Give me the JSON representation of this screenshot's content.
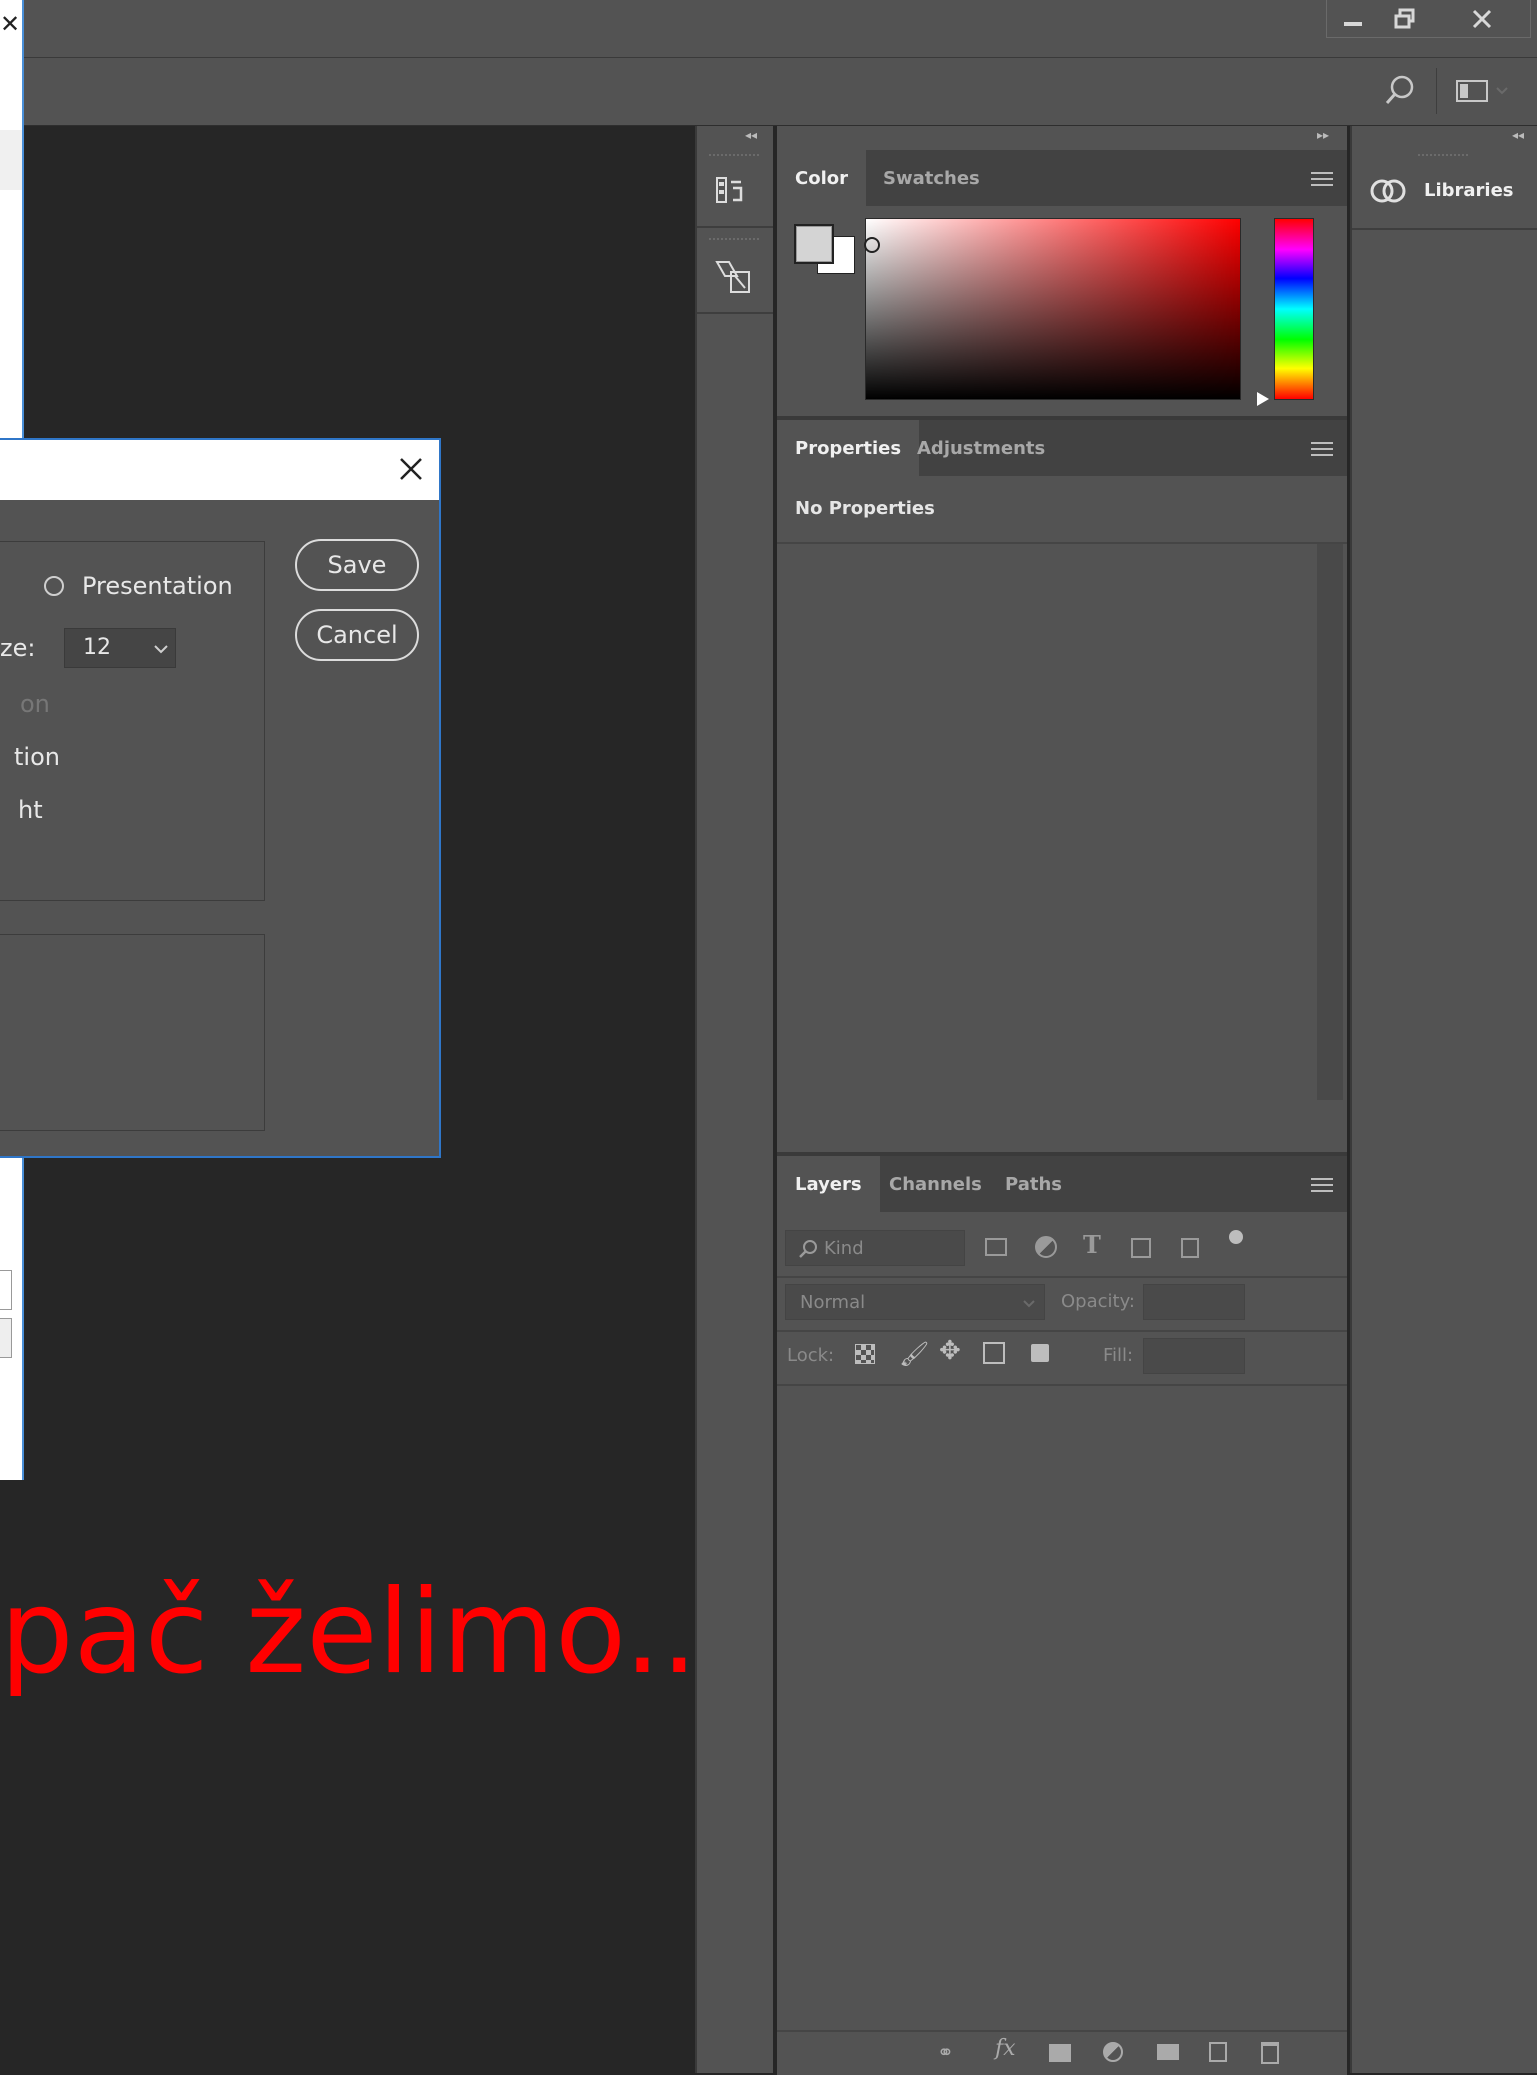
{
  "window": {
    "minimize_glyph": "–",
    "restore_glyph": "❐",
    "close_glyph": "✕",
    "search_glyph": "⌕"
  },
  "dialog": {
    "close_glyph": "✕",
    "radio_label": "Presentation",
    "size_label": "ze:",
    "size_value": "12",
    "partial_option_1": "on",
    "partial_option_2": "tion",
    "partial_option_3": "ht",
    "save_label": "Save",
    "cancel_label": "Cancel"
  },
  "canvas": {
    "text": "pač želimo...",
    "text_color": "#ff0000"
  },
  "color_panel": {
    "tabs": [
      "Color",
      "Swatches"
    ],
    "active_tab": "Color"
  },
  "properties_panel": {
    "tabs": [
      "Properties",
      "Adjustments"
    ],
    "active_tab": "Properties",
    "content": "No Properties"
  },
  "layers_panel": {
    "tabs": [
      "Layers",
      "Channels",
      "Paths"
    ],
    "active_tab": "Layers",
    "filter_kind": "Kind",
    "blend_mode": "Normal",
    "opacity_label": "Opacity:",
    "lock_label": "Lock:",
    "fill_label": "Fill:"
  },
  "libraries_panel": {
    "label": "Libraries"
  },
  "colors": {
    "accent_blue": "#2f76c8",
    "panel_bg": "#535353",
    "canvas_bg": "#262626"
  }
}
